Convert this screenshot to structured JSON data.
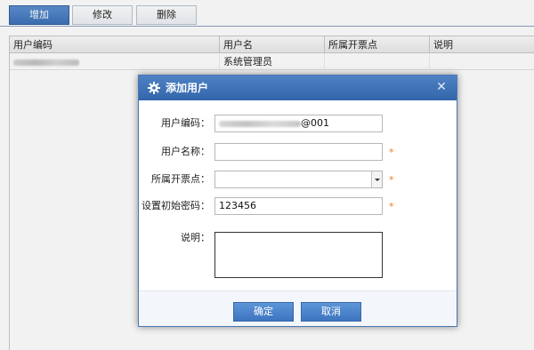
{
  "toolbar": {
    "add_label": "增加",
    "edit_label": "修改",
    "delete_label": "删除"
  },
  "grid": {
    "columns": [
      "用户编码",
      "用户名",
      "所属开票点",
      "说明"
    ],
    "rows": [
      {
        "user_name": "系统管理员",
        "invoice_point": "",
        "remark": ""
      }
    ]
  },
  "dialog": {
    "title": "添加用户",
    "icon": "gear-icon",
    "close_icon": "close-icon",
    "fields": {
      "user_code_label": "用户编码：",
      "user_code_suffix": "@001",
      "user_name_label": "用户名称：",
      "user_name_value": "",
      "invoice_point_label": "所属开票点：",
      "invoice_point_value": "",
      "password_label": "设置初始密码：",
      "password_value": "123456",
      "remark_label": "说明：",
      "remark_value": ""
    },
    "required_marker": "*",
    "confirm_label": "确定",
    "cancel_label": "取消"
  },
  "colors": {
    "title_bar": "#3a6eb3",
    "primary_button": "#4a82c9",
    "required": "#f07a1d"
  }
}
